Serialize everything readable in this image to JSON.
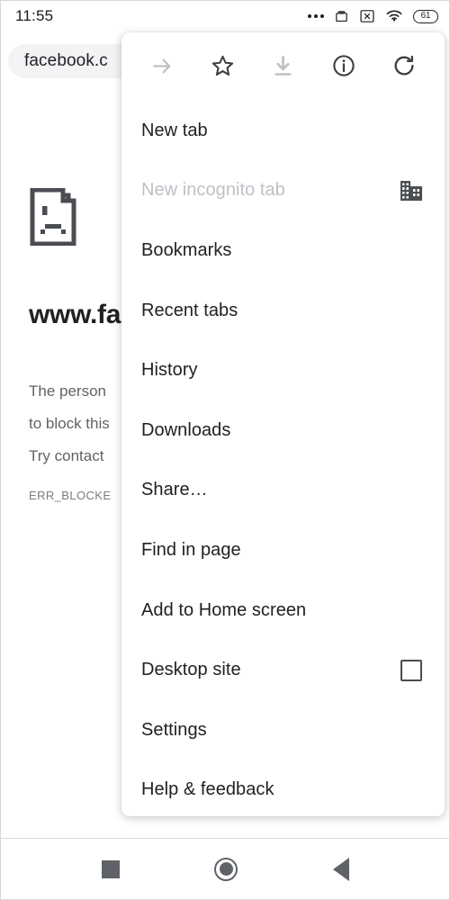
{
  "status_bar": {
    "clock": "11:55",
    "icons": [
      "more-dots-icon",
      "work-briefcase-icon",
      "x-box-icon",
      "wifi-icon",
      "battery-icon"
    ],
    "battery_level": "61"
  },
  "browser_toolbar": {
    "url_text": "facebook.c"
  },
  "error_page": {
    "icon": "sad-page-icon",
    "title": "www.fa",
    "body_line1": "The person",
    "body_line2": "to block this",
    "body_line3": "Try contact",
    "error_code": "ERR_BLOCKE"
  },
  "menu": {
    "toolbar_icons": [
      {
        "name": "forward-arrow-icon",
        "enabled": false
      },
      {
        "name": "bookmark-star-icon",
        "enabled": true
      },
      {
        "name": "download-icon",
        "enabled": false
      },
      {
        "name": "page-info-icon",
        "enabled": true
      },
      {
        "name": "reload-icon",
        "enabled": true
      }
    ],
    "items": [
      {
        "label": "New tab",
        "enabled": true,
        "trailing": "none"
      },
      {
        "label": "New incognito tab",
        "enabled": false,
        "trailing": "enterprise-building-icon"
      },
      {
        "label": "Bookmarks",
        "enabled": true,
        "trailing": "none"
      },
      {
        "label": "Recent tabs",
        "enabled": true,
        "trailing": "none"
      },
      {
        "label": "History",
        "enabled": true,
        "trailing": "none"
      },
      {
        "label": "Downloads",
        "enabled": true,
        "trailing": "none"
      },
      {
        "label": "Share…",
        "enabled": true,
        "trailing": "none"
      },
      {
        "label": "Find in page",
        "enabled": true,
        "trailing": "none"
      },
      {
        "label": "Add to Home screen",
        "enabled": true,
        "trailing": "none"
      },
      {
        "label": "Desktop site",
        "enabled": true,
        "trailing": "checkbox",
        "checked": false
      },
      {
        "label": "Settings",
        "enabled": true,
        "trailing": "none"
      },
      {
        "label": "Help & feedback",
        "enabled": true,
        "trailing": "none"
      }
    ]
  },
  "nav_bar": {
    "buttons": [
      "recents-square-icon",
      "home-circle-icon",
      "back-triangle-icon"
    ]
  },
  "colors": {
    "text_primary": "#202124",
    "text_secondary": "#5f6368",
    "text_disabled": "#bdc1c6",
    "omnibox_bg": "#f1f3f4",
    "icon_dark": "#3c4043"
  }
}
